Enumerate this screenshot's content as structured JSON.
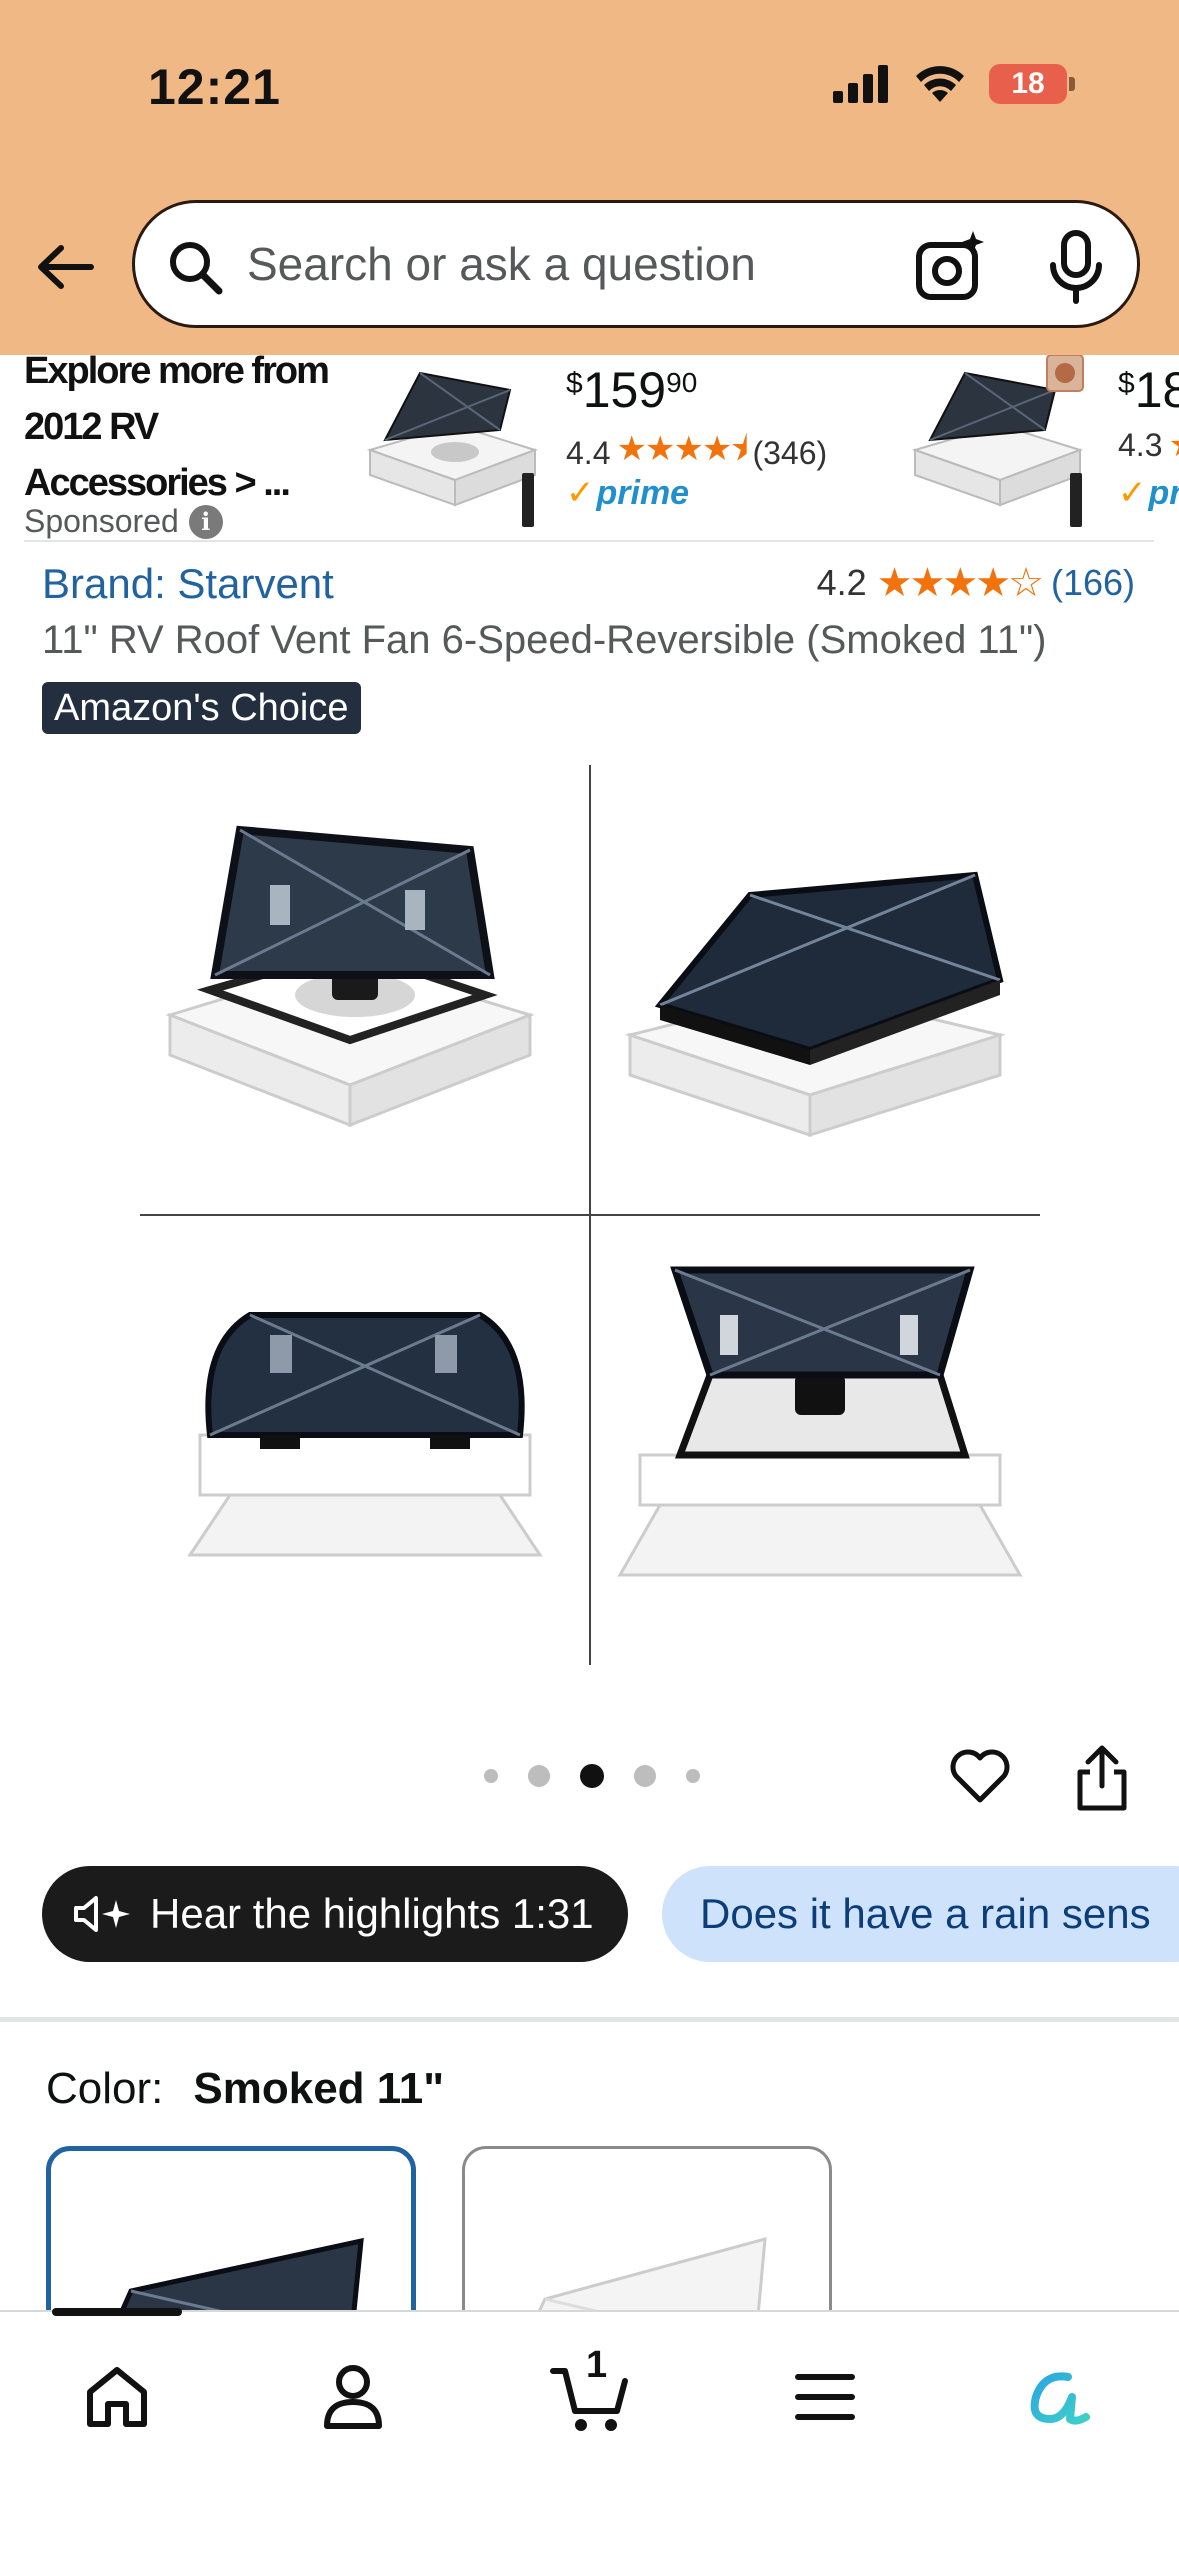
{
  "status_bar": {
    "time": "12:21",
    "battery": "18"
  },
  "search": {
    "placeholder": "Search or ask a question"
  },
  "sponsored": {
    "explore_text": "Explore more from 2012 RV Accessories > ...",
    "label": "Sponsored",
    "info_glyph": "i",
    "items": [
      {
        "price_currency": "$",
        "price_whole": "159",
        "price_fraction": "90",
        "rating": "4.4",
        "stars": "★★★★⯨",
        "review_count": "(346)",
        "prime_label": "prime",
        "prime_check": "✓"
      },
      {
        "price_currency": "$",
        "price_whole": "18",
        "rating": "4.3",
        "stars": "★",
        "prime_label": "pr",
        "prime_check": "✓"
      }
    ]
  },
  "product": {
    "brand": "Brand: Starvent",
    "rating": "4.2",
    "stars_filled": "★★★★",
    "stars_empty": "☆",
    "rating_count": "(166)",
    "title": "11\" RV Roof Vent Fan 6-Speed-Reversible (Smoked 11\")",
    "badge": "Amazon's Choice",
    "carousel_active_index": 3,
    "carousel_total": 5
  },
  "highlights": {
    "hear_label": "Hear the highlights 1:31",
    "hear_icon": "speaker-sparkle-icon",
    "question_label": "Does it have a rain sens"
  },
  "color": {
    "label": "Color:",
    "value": "Smoked 11\""
  },
  "tabbar": {
    "cart_count": "1",
    "tabs": [
      "home-icon",
      "account-icon",
      "cart-icon",
      "menu-icon",
      "rufus-icon"
    ]
  },
  "colors": {
    "header_bg": "#f0b884",
    "link_blue": "#2162a1",
    "star_orange": "#f2720c",
    "badge_bg": "#232f3e",
    "chip_light_bg": "#cfe2fb"
  }
}
